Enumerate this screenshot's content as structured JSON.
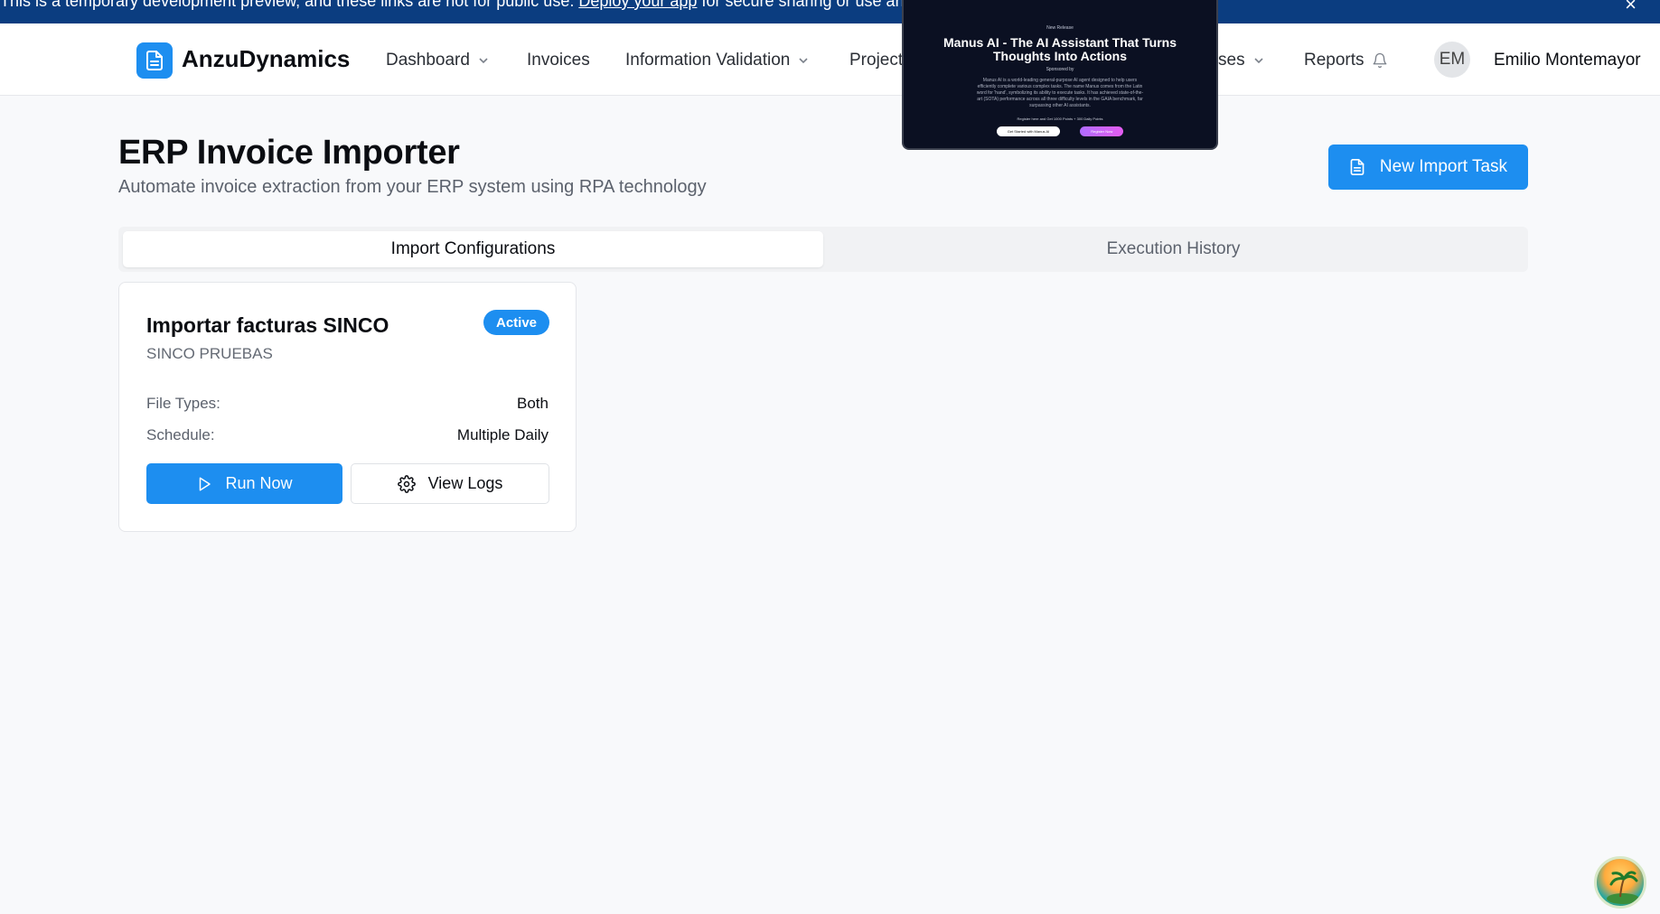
{
  "banner": {
    "text_before": "This is a temporary development preview, and these links are not for public use.",
    "link": "Deploy your app",
    "text_after": "for secure sharing or use an invi"
  },
  "brand": {
    "name": "AnzuDynamics"
  },
  "nav": {
    "dashboard": "Dashboard",
    "invoices": "Invoices",
    "information_validation": "Information Validation",
    "projects": "Project",
    "expenses": "ses",
    "reports": "Reports"
  },
  "user": {
    "initials": "EM",
    "name": "Emilio Montemayor"
  },
  "promo": {
    "tag": "New Release",
    "title": "Manus AI - The AI Assistant That Turns Thoughts Into Actions",
    "sponsor": "Sponsored by",
    "description": "Manus AI is a world-leading general-purpose AI agent designed to help users efficiently complete various complex tasks. The name Manus comes from the Latin word for 'hand', symbolizing its ability to execute tasks. It has achieved state-of-the-art (SOTA) performance across all three difficulty levels in the GAIA benchmark, far surpassing other AI assistants.",
    "note": "Register here and Get 1000 Points + 300 Daily Points",
    "btn_primary": "Get Started with Manus AI",
    "btn_secondary": "Register Now"
  },
  "page": {
    "title": "ERP Invoice Importer",
    "subtitle": "Automate invoice extraction from your ERP system using RPA technology",
    "new_task_label": "New Import Task"
  },
  "tabs": {
    "import_configurations": "Import Configurations",
    "execution_history": "Execution History"
  },
  "card": {
    "title": "Importar facturas SINCO",
    "subtitle": "SINCO PRUEBAS",
    "status": "Active",
    "file_types_label": "File Types:",
    "file_types_value": "Both",
    "schedule_label": "Schedule:",
    "schedule_value": "Multiple Daily",
    "run_label": "Run Now",
    "logs_label": "View Logs"
  },
  "colors": {
    "accent": "#1d8ef0",
    "banner": "#0b3d80",
    "background": "#f8f9fb"
  }
}
